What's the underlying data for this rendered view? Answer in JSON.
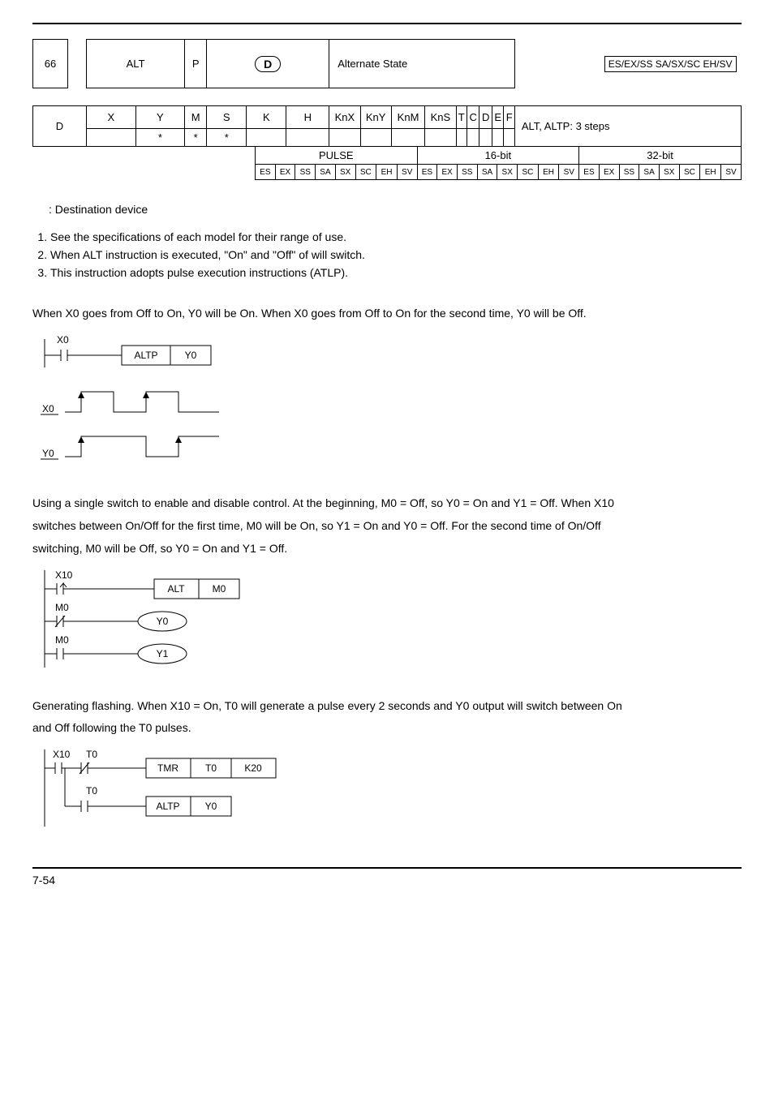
{
  "header": {
    "api_no": "66",
    "mnemonic": "ALT",
    "p_flag": "P",
    "operand_label": "D",
    "function_title": "Alternate State",
    "legend": "ES/EX/SS SA/SX/SC EH/SV"
  },
  "type_row": {
    "c0": "X",
    "c1": "Y",
    "c2": "M",
    "c3": "S",
    "c4": "K",
    "c5": "H",
    "c6": "KnX",
    "c7": "KnY",
    "c8": "KnM",
    "c9": "KnS",
    "c10": "T",
    "c11": "C",
    "c12": "D",
    "c13": "E",
    "c14": "F",
    "steps": "ALT, ALTP: 3 steps"
  },
  "d_row": {
    "label": "D",
    "c1": "*",
    "c2": "*",
    "c3": "*"
  },
  "pulse_row": {
    "group_pulse": "PULSE",
    "group_16": "16-bit",
    "group_32": "32-bit",
    "cells": [
      "ES",
      "EX",
      "SS",
      "SA",
      "SX",
      "SC",
      "EH",
      "SV",
      "ES",
      "EX",
      "SS",
      "SA",
      "SX",
      "SC",
      "EH",
      "SV",
      "ES",
      "EX",
      "SS",
      "SA",
      "SX",
      "SC",
      "EH",
      "SV"
    ]
  },
  "labels": {
    "dest": ": Destination device",
    "exp1": "See the specifications of each model for their range of use.",
    "exp2": "When ALT instruction is executed, \"On\" and \"Off\" of    will switch.",
    "exp3": "This instruction adopts pulse execution instructions (ATLP).",
    "para1": "When X0 goes from Off to On, Y0 will be On. When X0 goes from Off to On for the second time, Y0 will be Off.",
    "para2a": "Using a single switch to enable and disable control. At the beginning, M0 = Off, so Y0 = On and Y1 = Off. When X10",
    "para2b": "switches between On/Off for the first time, M0 will be On, so Y1 = On and Y0 = Off. For the second time of On/Off",
    "para2c": "switching, M0 will be Off, so Y0 = On and Y1 = Off.",
    "para3a": "Generating flashing. When X10 = On, T0 will generate a pulse every 2 seconds and Y0 output will switch between On",
    "para3b": "and Off following the T0 pulses."
  },
  "diagram1": {
    "x0": "X0",
    "altp": "ALTP",
    "y0": "Y0",
    "wave_x0": "X0",
    "wave_y0": "Y0"
  },
  "diagram2": {
    "x10": "X10",
    "alt": "ALT",
    "m0": "M0",
    "m0a": "M0",
    "m0b": "M0",
    "y0": "Y0",
    "y1": "Y1"
  },
  "diagram3": {
    "x10": "X10",
    "t0a": "T0",
    "t0b": "T0",
    "tmr": "TMR",
    "tmr_t0": "T0",
    "k20": "K20",
    "altp": "ALTP",
    "altp_y0": "Y0"
  },
  "footer": "7-54"
}
